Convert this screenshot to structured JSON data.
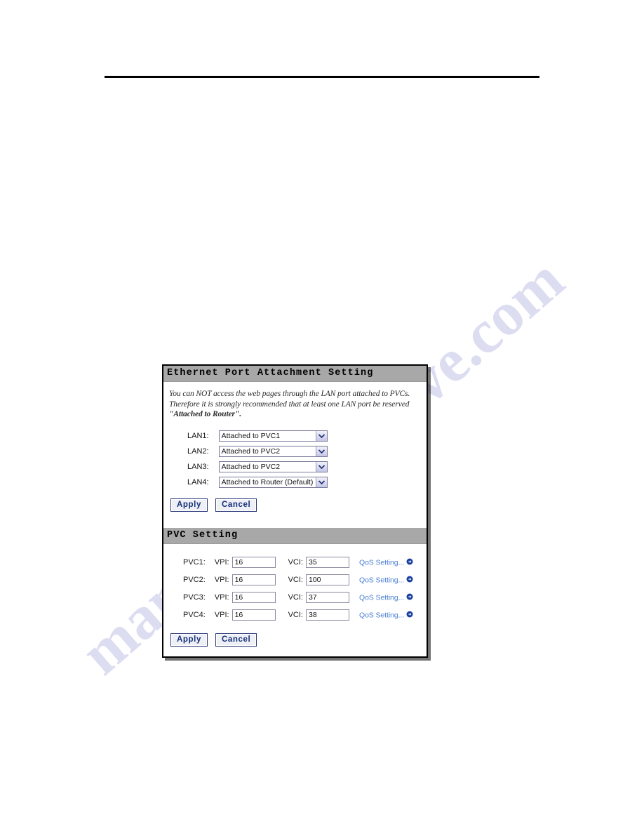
{
  "page": {
    "watermark_left": "manualshive",
    "watermark_right": "ve.com"
  },
  "panel": {
    "ethernet_section": {
      "title": "Ethernet Port Attachment Setting",
      "intro_line1": "You can NOT access the web pages through the LAN port attached to PVCs.",
      "intro_line2": "Therefore it is strongly recommended that at least one LAN port be reserved",
      "intro_line3_quote": "\"Attached to Router\".",
      "rows": [
        {
          "label": "LAN1:",
          "value": "Attached to PVC1"
        },
        {
          "label": "LAN2:",
          "value": "Attached to PVC2"
        },
        {
          "label": "LAN3:",
          "value": "Attached to PVC2"
        },
        {
          "label": "LAN4:",
          "value": "Attached to Router (Default)"
        }
      ],
      "apply_label": "Apply",
      "cancel_label": "Cancel"
    },
    "pvc_section": {
      "title": "PVC Setting",
      "vpi_label": "VPI:",
      "vci_label": "VCI:",
      "qos_link_label": "QoS Setting...",
      "rows": [
        {
          "label": "PVC1:",
          "vpi": "16",
          "vci": "35"
        },
        {
          "label": "PVC2:",
          "vpi": "16",
          "vci": "100"
        },
        {
          "label": "PVC3:",
          "vpi": "16",
          "vci": "37"
        },
        {
          "label": "PVC4:",
          "vpi": "16",
          "vci": "38"
        }
      ],
      "apply_label": "Apply",
      "cancel_label": "Cancel"
    }
  },
  "colors": {
    "section_header_bg": "#a8a8a8",
    "button_text": "#16307a",
    "link": "#4a7fd4",
    "watermark": "#c9c9ea"
  }
}
